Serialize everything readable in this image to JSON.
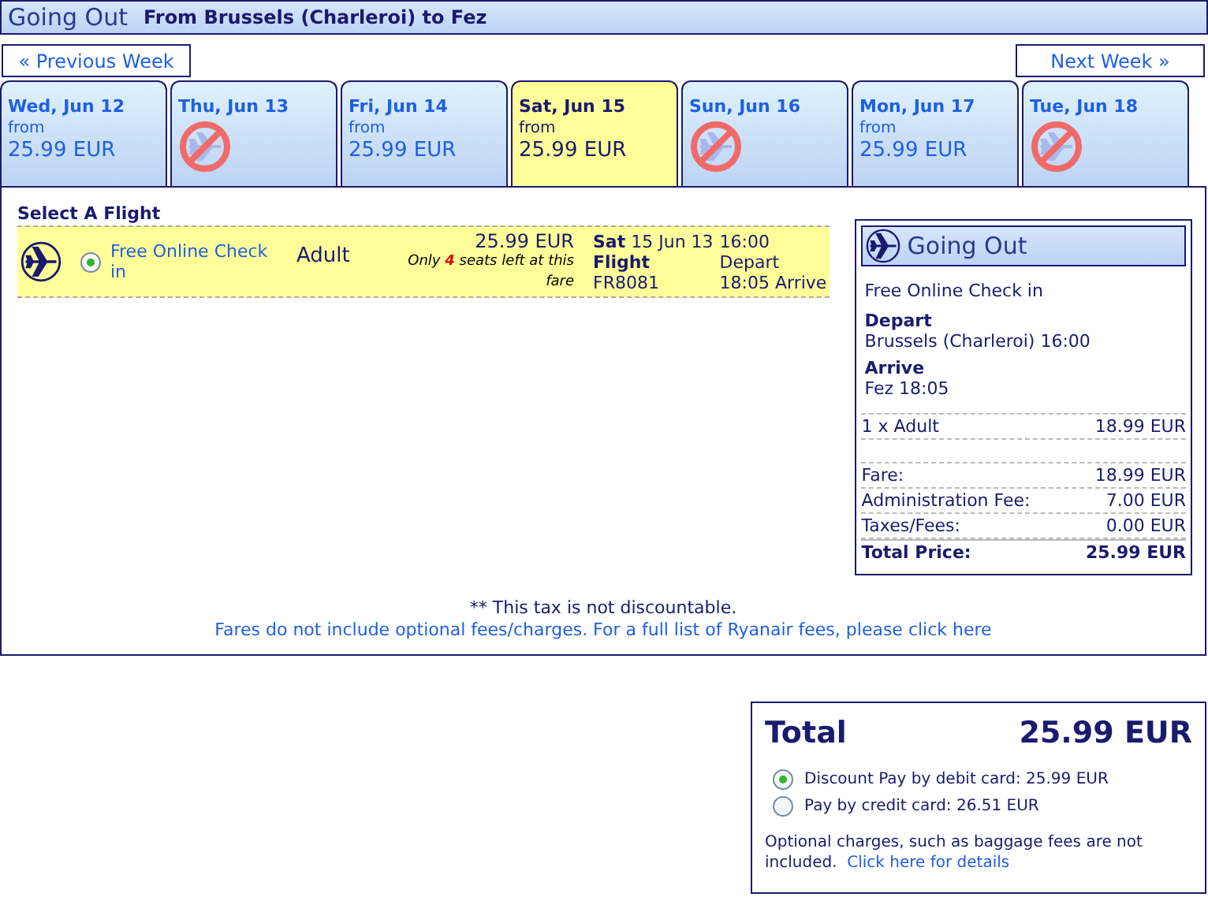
{
  "header": {
    "title": "Going Out",
    "route": "From Brussels (Charleroi) to Fez"
  },
  "week_nav": {
    "previous": "« Previous Week",
    "next": "Next Week »"
  },
  "days": [
    {
      "label": "Wed, Jun 12",
      "available": true,
      "from": "from",
      "price": "25.99 EUR",
      "selected": false
    },
    {
      "label": "Thu, Jun 13",
      "available": false,
      "selected": false
    },
    {
      "label": "Fri, Jun 14",
      "available": true,
      "from": "from",
      "price": "25.99 EUR",
      "selected": false
    },
    {
      "label": "Sat, Jun 15",
      "available": true,
      "from": "from",
      "price": "25.99 EUR",
      "selected": true
    },
    {
      "label": "Sun, Jun 16",
      "available": false,
      "selected": false
    },
    {
      "label": "Mon, Jun 17",
      "available": true,
      "from": "from",
      "price": "25.99 EUR",
      "selected": false
    },
    {
      "label": "Tue, Jun 18",
      "available": false,
      "selected": false
    }
  ],
  "flight_selection": {
    "heading": "Select A Flight",
    "flights": [
      {
        "selected": true,
        "check_in": "Free Online Check in",
        "passenger": "Adult",
        "price": "25.99 EUR",
        "seats_note": "Only **4** seats left at this fare",
        "date": "**Sat** 15 Jun 13",
        "flight_label": "Flight",
        "flight_number": "FR8081",
        "depart_time": "16:00",
        "depart_label": "Depart",
        "arrive": "18:05 Arrive"
      }
    ]
  },
  "summary": {
    "title": "Going Out",
    "check_in": "Free Online Check in",
    "depart_label": "Depart",
    "depart_value": "Brussels (Charleroi) 16:00",
    "arrive_label": "Arrive",
    "arrive_value": "Fez 18:05",
    "passenger_line": {
      "label": "1 x Adult",
      "value": "18.99 EUR"
    },
    "fees": [
      {
        "label": "Fare:",
        "value": "18.99 EUR"
      },
      {
        "label": "Administration Fee:",
        "value": "7.00 EUR"
      },
      {
        "label": "Taxes/Fees:",
        "value": "0.00 EUR"
      }
    ],
    "total": {
      "label": "Total Price:",
      "value": "25.99 EUR"
    }
  },
  "footer": {
    "note": "** This tax is not discountable.",
    "link": "Fares do not include optional fees/charges. For a full list of Ryanair fees, please click here"
  },
  "total_box": {
    "label": "Total",
    "amount": "25.99 EUR",
    "payment_options": [
      {
        "label": "Discount Pay by debit card: 25.99 EUR",
        "selected": true
      },
      {
        "label": "Pay by credit card: 26.51 EUR",
        "selected": false
      }
    ],
    "note": "Optional charges, such as baggage fees are not included.",
    "link": "Click here for details"
  }
}
